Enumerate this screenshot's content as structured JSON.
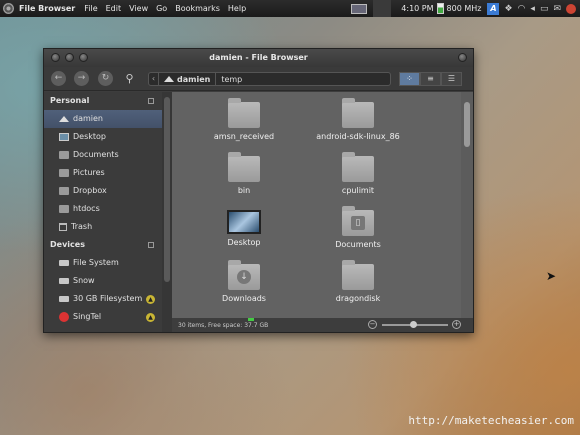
{
  "panel": {
    "app_name": "File Browser",
    "menus": [
      "File",
      "Edit",
      "View",
      "Go",
      "Bookmarks",
      "Help"
    ],
    "time": "4:10 PM",
    "cpu_freq": "800 MHz"
  },
  "window": {
    "title": "damien - File Browser",
    "breadcrumb": [
      "damien",
      "temp"
    ],
    "sidebar": {
      "personal_header": "Personal",
      "personal": [
        {
          "label": "damien",
          "icon": "home-icon",
          "selected": true
        },
        {
          "label": "Desktop",
          "icon": "desktop-icon"
        },
        {
          "label": "Documents",
          "icon": "folder-icon"
        },
        {
          "label": "Pictures",
          "icon": "folder-icon"
        },
        {
          "label": "Dropbox",
          "icon": "folder-icon"
        },
        {
          "label": "htdocs",
          "icon": "folder-icon"
        },
        {
          "label": "Trash",
          "icon": "trash-icon"
        }
      ],
      "devices_header": "Devices",
      "devices": [
        {
          "label": "File System",
          "icon": "drive-icon"
        },
        {
          "label": "Snow",
          "icon": "drive-icon"
        },
        {
          "label": "30 GB Filesystem",
          "icon": "drive-icon",
          "eject": true
        },
        {
          "label": "SingTel",
          "icon": "phone-icon",
          "eject": true
        }
      ]
    },
    "files": [
      {
        "name": "amsn_received",
        "icon": "folder-icon"
      },
      {
        "name": "android-sdk-linux_86",
        "icon": "folder-icon"
      },
      {
        "name": "bin",
        "icon": "folder-icon"
      },
      {
        "name": "cpulimit",
        "icon": "folder-icon"
      },
      {
        "name": "Desktop",
        "icon": "desktop-folder-icon"
      },
      {
        "name": "Documents",
        "icon": "documents-folder-icon"
      },
      {
        "name": "Downloads",
        "icon": "downloads-folder-icon"
      },
      {
        "name": "dragondisk",
        "icon": "folder-icon"
      }
    ],
    "status": "30 items, Free space: 37.7 GB"
  },
  "watermark": "http://maketecheasier.com"
}
